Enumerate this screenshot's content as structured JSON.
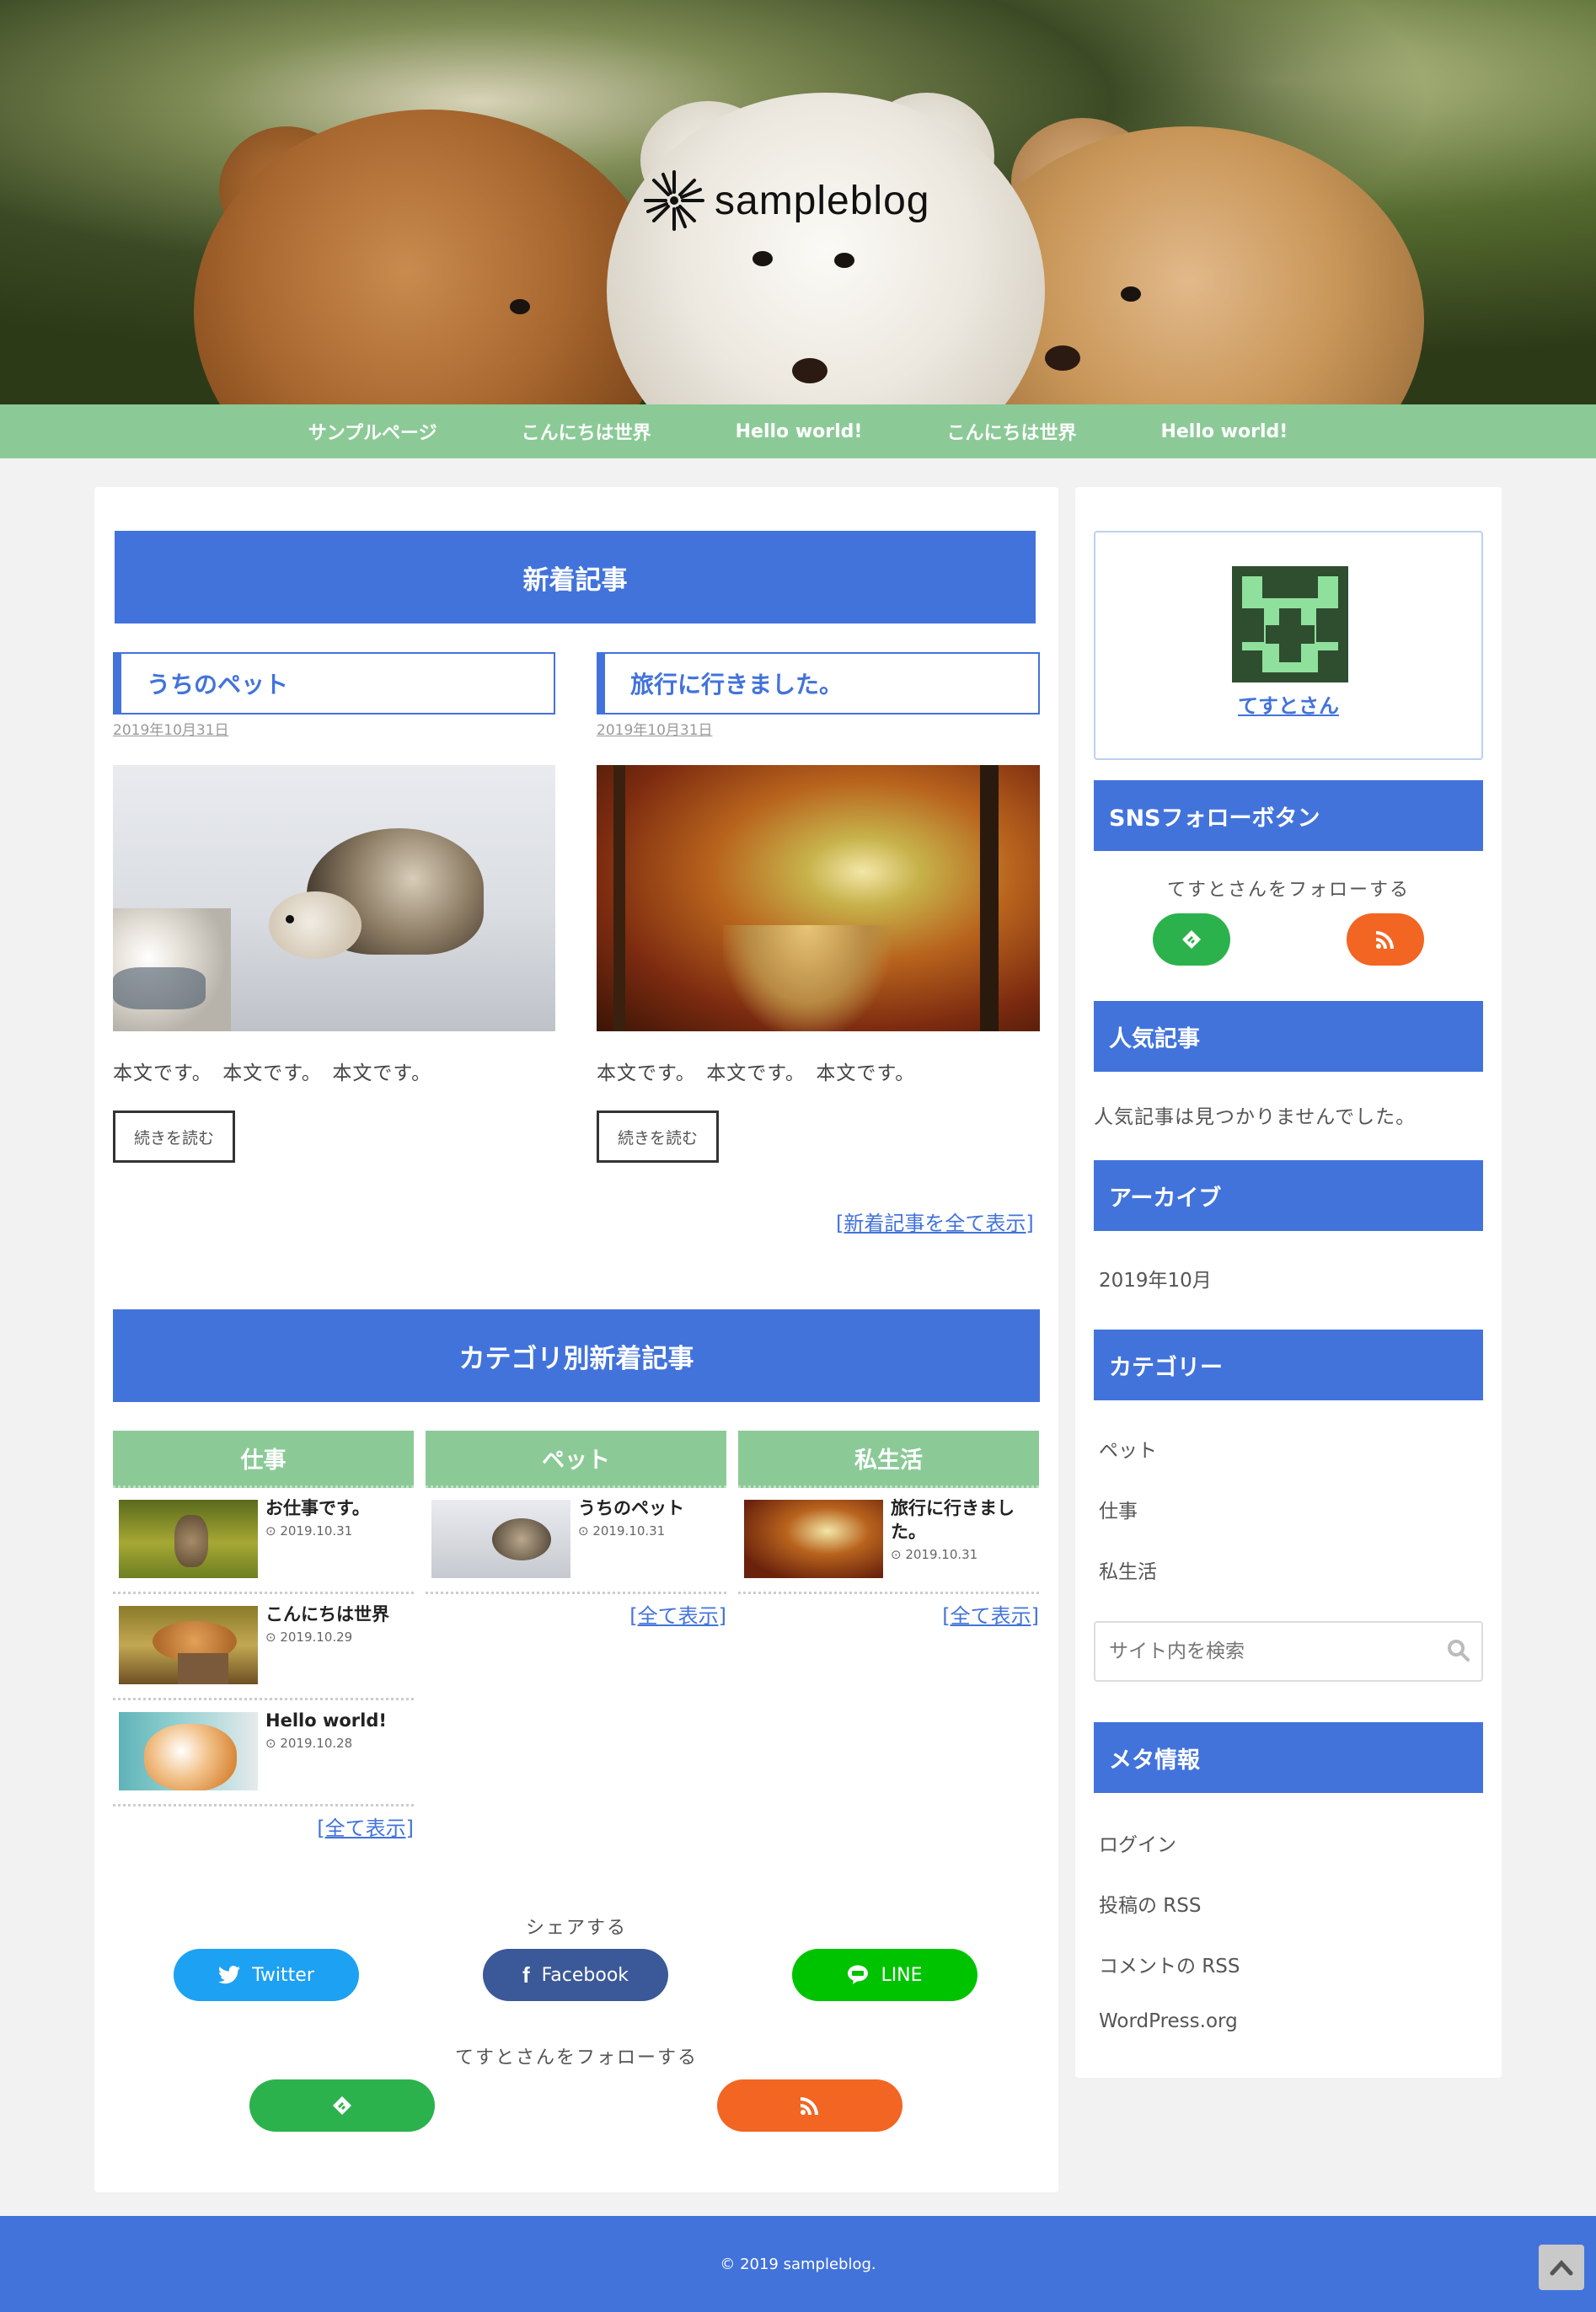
{
  "site": {
    "logo_text": "sampleblog"
  },
  "nav": {
    "items": [
      "サンプルページ",
      "こんにちは世界",
      "Hello world!",
      "こんにちは世界",
      "Hello world!"
    ]
  },
  "main": {
    "new_posts_title": "新着記事",
    "posts": [
      {
        "title": "うちのペット",
        "date": "2019年10月31日",
        "excerpt": "本文です。　本文です。　本文です。",
        "more": "続きを読む"
      },
      {
        "title": "旅行に行きました。",
        "date": "2019年10月31日",
        "excerpt": "本文です。　本文です。　本文です。",
        "more": "続きを読む"
      }
    ],
    "all_new_link": "[新着記事を全て表示]",
    "category_title": "カテゴリ別新着記事",
    "categories": [
      {
        "name": "仕事",
        "items": [
          {
            "title": "お仕事です。",
            "date": "2019.10.31"
          },
          {
            "title": "こんにちは世界",
            "date": "2019.10.29"
          },
          {
            "title": "Hello world!",
            "date": "2019.10.28"
          }
        ],
        "more": "[全て表示]"
      },
      {
        "name": "ペット",
        "items": [
          {
            "title": "うちのペット",
            "date": "2019.10.31"
          }
        ],
        "more": "[全て表示]"
      },
      {
        "name": "私生活",
        "items": [
          {
            "title": "旅行に行きました。",
            "date": "2019.10.31"
          }
        ],
        "more": "[全て表示]"
      }
    ],
    "share_label": "シェアする",
    "share_buttons": [
      "Twitter",
      "Facebook",
      "LINE"
    ],
    "follow_label": "てすとさんをフォローする"
  },
  "sidebar": {
    "author_name": "てすとさん",
    "sns_title": "SNSフォローボタン",
    "sns_follow_label": "てすとさんをフォローする",
    "popular_title": "人気記事",
    "popular_empty": "人気記事は見つかりませんでした。",
    "archive_title": "アーカイブ",
    "archive_items": [
      "2019年10月"
    ],
    "category_title": "カテゴリー",
    "category_items": [
      "ペット",
      "仕事",
      "私生活"
    ],
    "search_placeholder": "サイト内を検索",
    "meta_title": "メタ情報",
    "meta_items": [
      "ログイン",
      "投稿の RSS",
      "コメントの RSS",
      "WordPress.org"
    ]
  },
  "footer": {
    "copyright": "© 2019 sampleblog."
  },
  "colors": {
    "accent": "#4273db",
    "nav": "#8bca96",
    "twitter": "#1da1f2",
    "facebook": "#3b5998",
    "line": "#00c300",
    "feedly": "#2bb24c",
    "rss": "#f26522"
  }
}
